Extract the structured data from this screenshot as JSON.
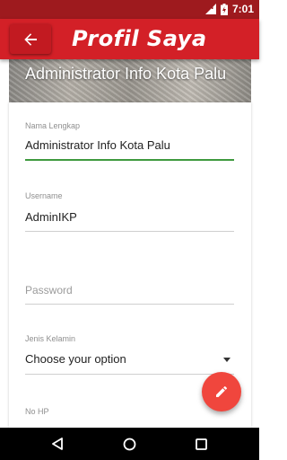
{
  "status_bar": {
    "time": "7:01"
  },
  "app_bar": {
    "title": "Profil Saya"
  },
  "header": {
    "name": "Administrator Info Kota Palu"
  },
  "form": {
    "full_name": {
      "label": "Nama Lengkap",
      "value": "Administrator Info Kota Palu"
    },
    "username": {
      "label": "Username",
      "value": "AdminIKP"
    },
    "password": {
      "placeholder": "Password"
    },
    "gender": {
      "label": "Jenis Kelamin",
      "value": "Choose your option"
    },
    "phone": {
      "label": "No HP"
    }
  },
  "colors": {
    "primary": "#d32027",
    "status_bar": "#9e1a1e",
    "accent": "#f0463d",
    "focus_line": "#3f9a3f"
  },
  "icons": {
    "back": "arrow-left-icon",
    "edit": "pencil-icon",
    "nav": [
      "back-triangle-icon",
      "home-circle-icon",
      "recents-square-icon"
    ]
  }
}
